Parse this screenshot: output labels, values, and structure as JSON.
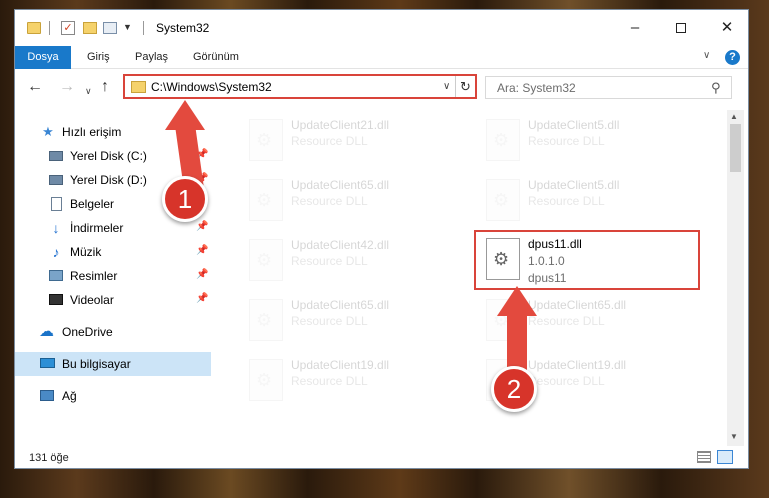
{
  "window": {
    "title": "System32",
    "quick_access": [
      "folder-icon",
      "properties-check-icon",
      "new-folder-icon",
      "properties-icon",
      "customize-down-icon"
    ],
    "controls": {
      "minimize": "–",
      "maximize": "",
      "close": "✕"
    }
  },
  "ribbon": {
    "tabs": [
      "Dosya",
      "Giriş",
      "Paylaş",
      "Görünüm"
    ],
    "chevron": "∨",
    "help": "?"
  },
  "nav": {
    "back": "←",
    "forward": "→",
    "recent": "∨",
    "up": "↑",
    "address": "C:\\Windows\\System32",
    "address_chevron": "∨",
    "refresh": "↻",
    "search_placeholder": "Ara: System32",
    "search_icon": "⚲"
  },
  "sidebar": {
    "items": [
      {
        "label": "Hızlı erişim",
        "icon": "star-icon",
        "pinned": false
      },
      {
        "label": "Yerel Disk (C:)",
        "icon": "drive-icon",
        "pinned": true
      },
      {
        "label": "Yerel Disk (D:)",
        "icon": "drive-icon",
        "pinned": true
      },
      {
        "label": "Belgeler",
        "icon": "documents-icon",
        "pinned": true
      },
      {
        "label": "İndirmeler",
        "icon": "downloads-icon",
        "pinned": true
      },
      {
        "label": "Müzik",
        "icon": "music-icon",
        "pinned": true
      },
      {
        "label": "Resimler",
        "icon": "pictures-icon",
        "pinned": true
      },
      {
        "label": "Videolar",
        "icon": "videos-icon",
        "pinned": true
      },
      {
        "label": "OneDrive",
        "icon": "onedrive-icon",
        "pinned": false
      },
      {
        "label": "Bu bilgisayar",
        "icon": "this-pc-icon",
        "pinned": false,
        "selected": true
      },
      {
        "label": "Ağ",
        "icon": "network-icon",
        "pinned": false
      }
    ],
    "pin_glyph": "📌"
  },
  "files": [
    {
      "name": "UpdateClient21.dll",
      "line2": "Resource DLL",
      "line3": "",
      "faded": true
    },
    {
      "name": "UpdateClient5.dll",
      "line2": "Resource DLL",
      "line3": "",
      "faded": true
    },
    {
      "name": "UpdateClient65.dll",
      "line2": "Resource DLL",
      "line3": "",
      "faded": true
    },
    {
      "name": "UpdateClient5.dll",
      "line2": "Resource DLL",
      "line3": "",
      "faded": true
    },
    {
      "name": "UpdateClient42.dll",
      "line2": "Resource DLL",
      "line3": "",
      "faded": true
    },
    {
      "name": "dpus11.dll",
      "line2": "1.0.1.0",
      "line3": "dpus11",
      "faded": false,
      "highlighted": true
    },
    {
      "name": "UpdateClient65.dll",
      "line2": "Resource DLL",
      "line3": "",
      "faded": true
    },
    {
      "name": "UpdateClient65.dll",
      "line2": "Resource DLL",
      "line3": "",
      "faded": true
    },
    {
      "name": "UpdateClient19.dll",
      "line2": "Resource DLL",
      "line3": "",
      "faded": true
    },
    {
      "name": "UpdateClient19.dll",
      "line2": "Resource DLL",
      "line3": "",
      "faded": true
    }
  ],
  "status": {
    "item_count": "131 öğe"
  },
  "annotations": {
    "badge1": "1",
    "badge2": "2",
    "color": "#e34a3e"
  }
}
